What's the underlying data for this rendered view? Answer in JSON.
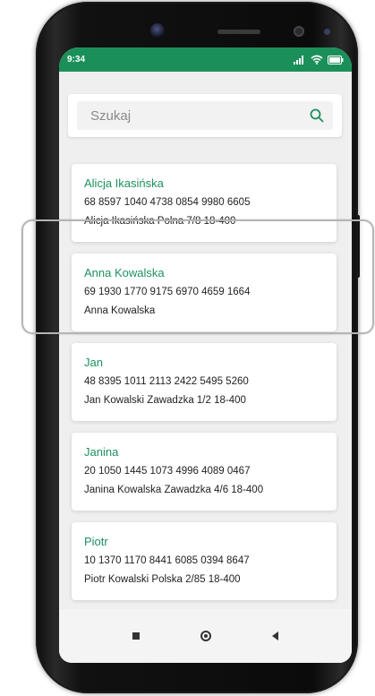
{
  "statusbar": {
    "time": "9:34",
    "signal_icon": "signal-icon",
    "wifi_icon": "wifi-icon",
    "battery_icon": "battery-icon"
  },
  "search": {
    "placeholder": "Szukaj",
    "value": "",
    "icon": "search-icon"
  },
  "contacts": [
    {
      "name": "Alicja Ikasińska",
      "account": "68 8597 1040 4738 0854 9980 6605",
      "description": "Alicja Ikasińska Polna 7/8 18-400"
    },
    {
      "name": "Anna Kowalska",
      "account": "69 1930 1770 9175 6970 4659 1664",
      "description": "Anna Kowalska"
    },
    {
      "name": "Jan",
      "account": "48 8395 1011 2113 2422 5495 5260",
      "description": "Jan Kowalski Zawadzka 1/2 18-400"
    },
    {
      "name": "Janina",
      "account": "20 1050 1445 1073 4996 4089 0467",
      "description": "Janina Kowalska Zawadzka 4/6 18-400"
    },
    {
      "name": "Piotr",
      "account": "10 1370 1170 8441 6085 0394 8647",
      "description": "Piotr Kowalski Polska 2/85 18-400"
    }
  ],
  "navbar": {
    "recents_icon": "recents-square-icon",
    "home_icon": "home-circle-icon",
    "back_icon": "back-triangle-icon"
  },
  "colors": {
    "status_bar": "#1b8f5a",
    "contact_name": "#1d9160",
    "screen_background": "#efefef",
    "highlight_outline": "#b5b5b5"
  }
}
